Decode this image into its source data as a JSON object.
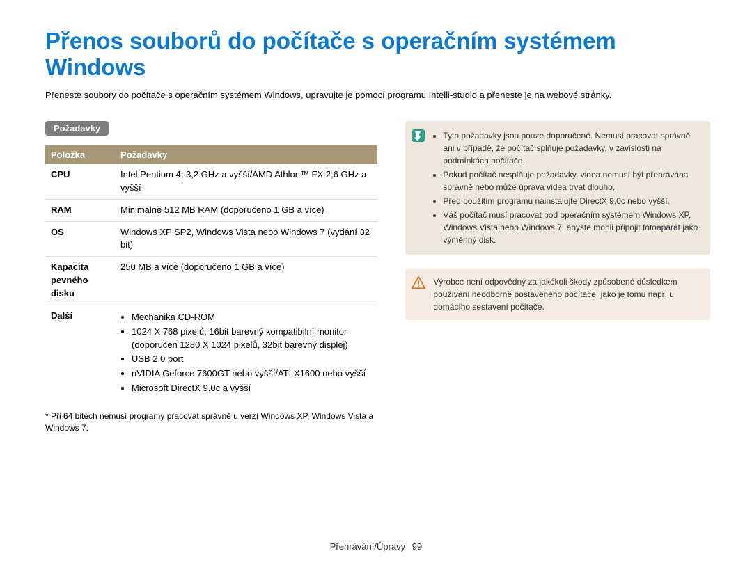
{
  "title": "Přenos souborů do počítače s operačním systémem Windows",
  "intro": "Přeneste soubory do počítače s operačním systémem Windows, upravujte je pomocí programu Intelli-studio a přeneste je na webové stránky.",
  "section_label": "Požadavky",
  "table": {
    "headers": {
      "item": "Položka",
      "req": "Požadavky"
    },
    "rows": {
      "cpu": {
        "key": "CPU",
        "val": "Intel Pentium 4, 3,2 GHz a vyšší/AMD Athlon™ FX 2,6 GHz a vyšší"
      },
      "ram": {
        "key": "RAM",
        "val": "Minimálně 512 MB RAM (doporučeno 1 GB a více)"
      },
      "os": {
        "key": "OS",
        "val": "Windows XP SP2, Windows Vista nebo Windows 7 (vydání 32 bit)"
      },
      "disk": {
        "key": "Kapacita pevného disku",
        "val": "250 MB a více (doporučeno 1 GB a více)"
      },
      "other": {
        "key": "Další",
        "items": [
          "Mechanika CD-ROM",
          "1024 X 768 pixelů, 16bit barevný kompatibilní monitor (doporučen 1280 X 1024 pixelů, 32bit barevný displej)",
          "USB 2.0 port",
          "nVIDIA Geforce 7600GT nebo vyšší/ATI X1600 nebo vyšší",
          "Microsoft DirectX 9.0c a vyšší"
        ]
      }
    }
  },
  "footnote": "* Při 64 bitech nemusí programy pracovat správně u verzí Windows XP, Windows Vista a Windows 7.",
  "info_notes": [
    "Tyto požadavky jsou pouze doporučené. Nemusí pracovat správně ani v případě, že počítač splňuje požadavky, v závislosti na podmínkách počítače.",
    "Pokud počítač nesplňuje požadavky, videa nemusí být přehrávána správně nebo může úprava videa trvat dlouho.",
    "Před použitím programu nainstalujte DirectX 9.0c nebo vyšší.",
    "Váš počítač musí pracovat pod operačním systémem Windows XP, Windows Vista nebo Windows 7, abyste mohli připojit fotoaparát jako výměnný disk."
  ],
  "warn_note": "Výrobce není odpovědný za jakékoli škody způsobené důsledkem používání neodborně postaveného počítače, jako je tomu např. u domácího sestavení počítače.",
  "footer": {
    "crumb": "Přehrávání/Úpravy",
    "page": "99"
  }
}
